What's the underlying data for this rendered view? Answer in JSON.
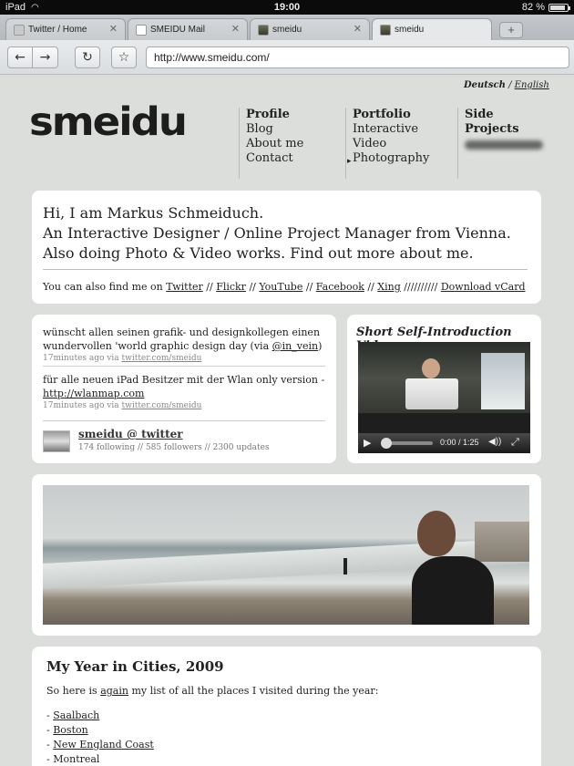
{
  "status_bar": {
    "device": "iPad",
    "time": "19:00",
    "battery": "82 %"
  },
  "tabs": [
    {
      "label": "Twitter / Home",
      "favicon": "twitter-icon",
      "close": "✕"
    },
    {
      "label": "SMEIDU Mail",
      "favicon": "gmail-icon",
      "close": "✕"
    },
    {
      "label": "smeidu",
      "favicon": "photo-icon",
      "close": "✕"
    },
    {
      "label": "smeidu",
      "favicon": "photo-icon",
      "close": ""
    }
  ],
  "toolbar": {
    "back": "←",
    "forward": "→",
    "reload": "↻",
    "bookmark": "☆",
    "url": "http://www.smeidu.com/",
    "new_tab": "+"
  },
  "lang": {
    "de": "Deutsch",
    "sep": "/",
    "en": "English"
  },
  "logo": "smeidu",
  "nav": {
    "profile": {
      "head": "Profile",
      "items": [
        "Blog",
        "About me",
        "Contact"
      ]
    },
    "portfolio": {
      "head": "Portfolio",
      "items": [
        "Interactive",
        "Video",
        "Photography"
      ],
      "active_marker": "▸"
    },
    "side": {
      "head": "Side Projects"
    }
  },
  "intro": {
    "line1": "Hi, I am Markus Schmeiduch.",
    "line2": "An Interactive Designer / Online Project Manager from Vienna.",
    "line3": "Also doing Photo & Video works. Find out more about me.",
    "social_prefix": "You can also find me on",
    "social_links": [
      "Twitter",
      "Flickr",
      "YouTube",
      "Facebook",
      "Xing"
    ],
    "social_sep": "//",
    "trail": "//////////",
    "vcard": "Download vCard"
  },
  "tweets": [
    {
      "text_a": "wünscht allen seinen grafik- und designkollegen einen wundervollen 'world graphic design day  (via ",
      "mention": "@in_vein",
      "text_b": ")",
      "time": "17minutes ago via",
      "source": "twitter.com/smeidu"
    },
    {
      "text_a": "für alle neuen iPad Besitzer mit der Wlan only version -",
      "link": "http://wlanmap.com",
      "time": "17minutes ago via",
      "source": "twitter.com/smeidu"
    }
  ],
  "twitter_user": {
    "name": "smeidu @ twitter",
    "stats": "174 following // 585 followers // 2300 updates"
  },
  "video": {
    "title": "Short Self-Introduction Video",
    "play": "▶",
    "time": "0:00 / 1:25",
    "volume": "◀))",
    "fullscreen": "⤢"
  },
  "cities": {
    "title": "My Year in Cities, 2009",
    "intro_a": "So here is ",
    "intro_link": "again",
    "intro_b": " my list of all the places I visited during the year:",
    "items": [
      {
        "name": "Saalbach",
        "linked": true
      },
      {
        "name": "Boston",
        "linked": true
      },
      {
        "name": "New England Coast",
        "linked": true
      },
      {
        "name": "Montreal",
        "linked": false
      }
    ]
  }
}
